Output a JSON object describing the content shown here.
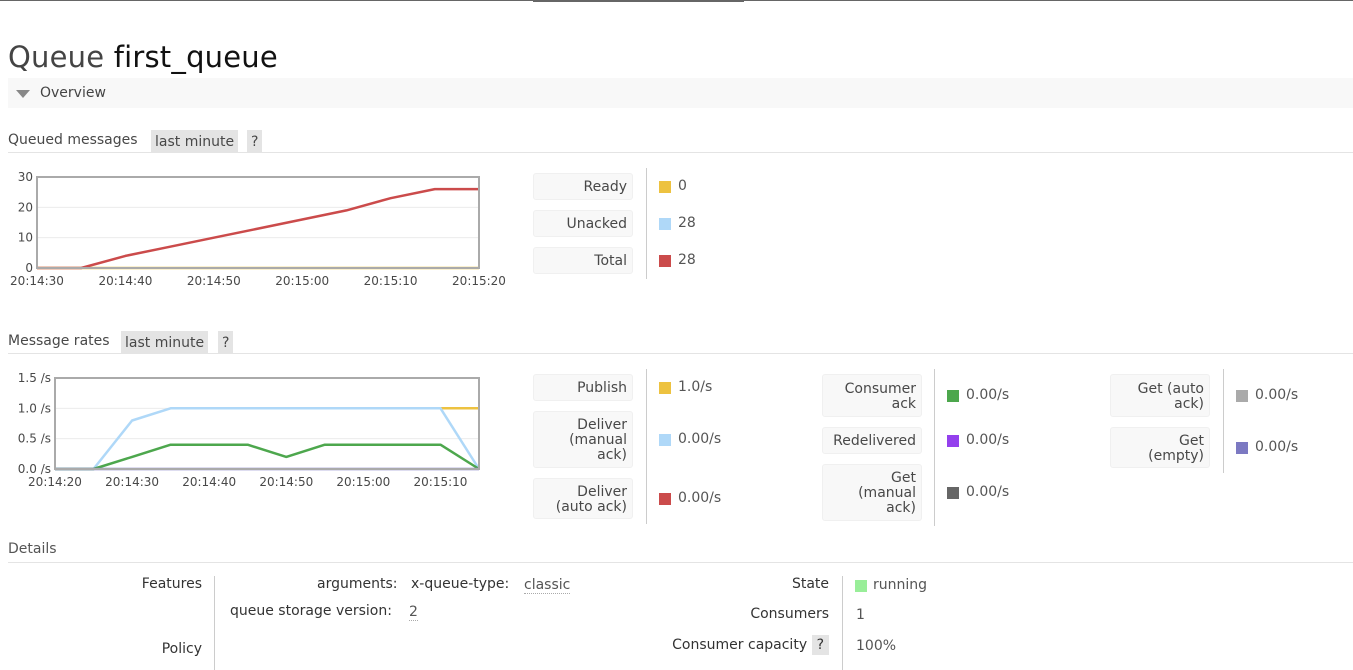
{
  "page": {
    "title_prefix": "Queue",
    "title_name": "first_queue",
    "section": "Overview"
  },
  "queued": {
    "heading": "Queued messages",
    "range": "last minute",
    "help": "?",
    "stats": [
      {
        "label": "Ready",
        "value": "0",
        "color": "#edc240"
      },
      {
        "label": "Unacked",
        "value": "28",
        "color": "#afd8f8"
      },
      {
        "label": "Total",
        "value": "28",
        "color": "#cb4b4b"
      }
    ]
  },
  "rates": {
    "heading": "Message rates",
    "range": "last minute",
    "help": "?",
    "col1": [
      {
        "label": "Publish",
        "value": "1.0/s",
        "color": "#edc240"
      },
      {
        "label": "Deliver (manual ack)",
        "lines": [
          "Deliver",
          "(manual",
          "ack)"
        ],
        "value": "0.00/s",
        "color": "#afd8f8"
      },
      {
        "label": "Deliver (auto ack)",
        "lines": [
          "Deliver",
          "(auto ack)"
        ],
        "value": "0.00/s",
        "color": "#cb4b4b"
      }
    ],
    "col2": [
      {
        "label": "Consumer ack",
        "lines": [
          "Consumer",
          "ack"
        ],
        "value": "0.00/s",
        "color": "#4da74d"
      },
      {
        "label": "Redelivered",
        "lines": [
          "Redelivered"
        ],
        "value": "0.00/s",
        "color": "#9440ed"
      },
      {
        "label": "Get (manual ack)",
        "lines": [
          "Get",
          "(manual",
          "ack)"
        ],
        "value": "0.00/s",
        "color": "#666666"
      }
    ],
    "col3": [
      {
        "label": "Get (auto ack)",
        "lines": [
          "Get (auto",
          "ack)"
        ],
        "value": "0.00/s",
        "color": "#aaaaaa"
      },
      {
        "label": "Get (empty)",
        "lines": [
          "Get",
          "(empty)"
        ],
        "value": "0.00/s",
        "color": "#7c79c2"
      }
    ]
  },
  "details": {
    "heading": "Details",
    "features_label": "Features",
    "arguments_label": "arguments:",
    "arg_key": "x-queue-type:",
    "arg_value": "classic",
    "storage_label": "queue storage version:",
    "storage_value": "2",
    "policy_label": "Policy",
    "state_label": "State",
    "state_value": "running",
    "state_color": "#99ee99",
    "consumers_label": "Consumers",
    "consumers_value": "1",
    "capacity_label": "Consumer capacity",
    "capacity_help": "?",
    "capacity_value": "100%"
  },
  "chart_data": [
    {
      "type": "line",
      "title": "Queued messages",
      "x": [
        "20:14:30",
        "20:14:35",
        "20:14:40",
        "20:14:45",
        "20:14:50",
        "20:14:55",
        "20:15:00",
        "20:15:05",
        "20:15:10",
        "20:15:15",
        "20:15:20"
      ],
      "xticks": [
        "20:14:30",
        "20:14:40",
        "20:14:50",
        "20:15:00",
        "20:15:10",
        "20:15:20"
      ],
      "yticks": [
        "0",
        "10",
        "20",
        "30"
      ],
      "ylim": [
        0,
        30
      ],
      "grid": true,
      "series": [
        {
          "name": "Ready",
          "color": "#edc240",
          "values": [
            0,
            0,
            0,
            0,
            0,
            0,
            0,
            0,
            0,
            0,
            0
          ]
        },
        {
          "name": "Total",
          "color": "#cb4b4b",
          "values": [
            0,
            0,
            4,
            7,
            10,
            13,
            16,
            19,
            23,
            26,
            26
          ]
        }
      ]
    },
    {
      "type": "line",
      "title": "Message rates",
      "x": [
        "20:14:20",
        "20:14:25",
        "20:14:30",
        "20:14:35",
        "20:14:40",
        "20:14:45",
        "20:14:50",
        "20:14:55",
        "20:15:00",
        "20:15:05",
        "20:15:10",
        "20:15:15"
      ],
      "xticks": [
        "20:14:20",
        "20:14:30",
        "20:14:40",
        "20:14:50",
        "20:15:00",
        "20:15:10"
      ],
      "yticks": [
        "0.0 /s",
        "0.5 /s",
        "1.0 /s",
        "1.5 /s"
      ],
      "ylim": [
        0,
        1.5
      ],
      "grid": true,
      "series": [
        {
          "name": "Publish",
          "color": "#edc240",
          "values": [
            null,
            null,
            null,
            null,
            null,
            null,
            null,
            null,
            null,
            null,
            1.0,
            1.0
          ]
        },
        {
          "name": "Deliver (manual ack)",
          "color": "#afd8f8",
          "values": [
            0,
            0,
            0.8,
            1.0,
            1.0,
            1.0,
            1.0,
            1.0,
            1.0,
            1.0,
            1.0,
            0
          ]
        },
        {
          "name": "Consumer ack",
          "color": "#4da74d",
          "values": [
            0,
            0,
            0.2,
            0.4,
            0.4,
            0.4,
            0.2,
            0.4,
            0.4,
            0.4,
            0.4,
            0
          ]
        },
        {
          "name": "Get (empty)",
          "color": "#7c79c2",
          "values": [
            0,
            0,
            0,
            0,
            0,
            0,
            0,
            0,
            0,
            0,
            0,
            0
          ]
        }
      ]
    }
  ]
}
